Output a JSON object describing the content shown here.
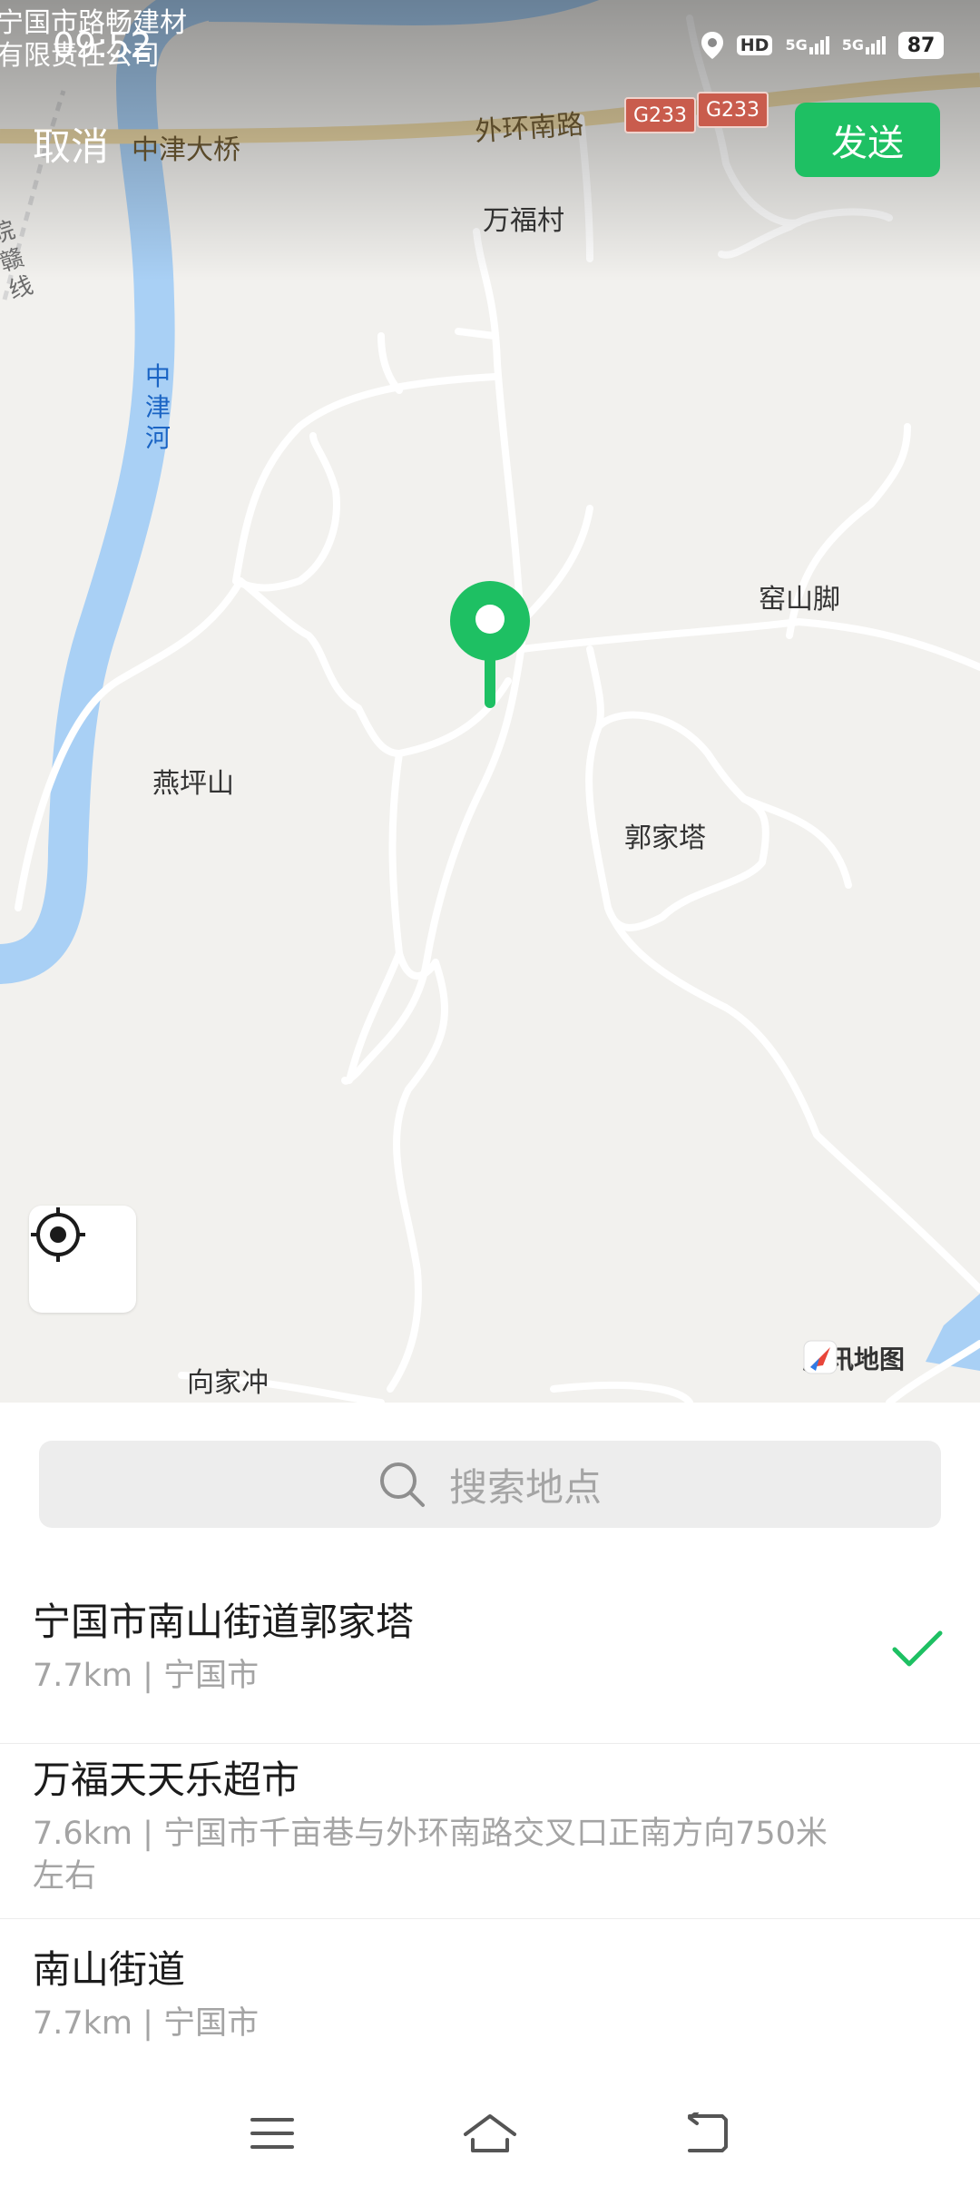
{
  "status_bar": {
    "time": "09:52",
    "hd_label": "HD",
    "signal1_label": "5G",
    "signal2_label": "5G",
    "battery": "87"
  },
  "header": {
    "cancel_label": "取消",
    "send_label": "发送"
  },
  "map": {
    "overlay_place_name": "宁国市路畅建材有限责任公司",
    "labels": {
      "bridge": "中津大桥",
      "road": "外环南路",
      "highway_1": "G233",
      "highway_2": "G233",
      "village_wanfu": "万福村",
      "railway": "皖赣线",
      "river": "中津河",
      "yaoshanjiao": "窑山脚",
      "yanpingshan": "燕坪山",
      "guojiata": "郭家塔",
      "xiangjiachong": "向家冲"
    },
    "watermark": "腾讯地图",
    "pin_color": "#1ec063"
  },
  "search": {
    "placeholder": "搜索地点"
  },
  "results": [
    {
      "title": "宁国市南山街道郭家塔",
      "subtitle": "7.7km | 宁国市",
      "selected": true
    },
    {
      "title": "万福天天乐超市",
      "subtitle": "7.6km | 宁国市千亩巷与外环南路交叉口正南方向750米左右",
      "selected": false
    },
    {
      "title": "南山街道",
      "subtitle": "7.7km | 宁国市",
      "selected": false
    }
  ],
  "colors": {
    "accent": "#1ec063",
    "water": "#a9d0f5",
    "map_background": "#f2f1ee"
  },
  "icons": {
    "search": "search-icon",
    "check": "check-icon",
    "locate": "locate-icon",
    "pin": "location-pin-icon",
    "nav_menu": "menu-icon",
    "nav_home": "home-icon",
    "nav_back": "back-icon"
  }
}
